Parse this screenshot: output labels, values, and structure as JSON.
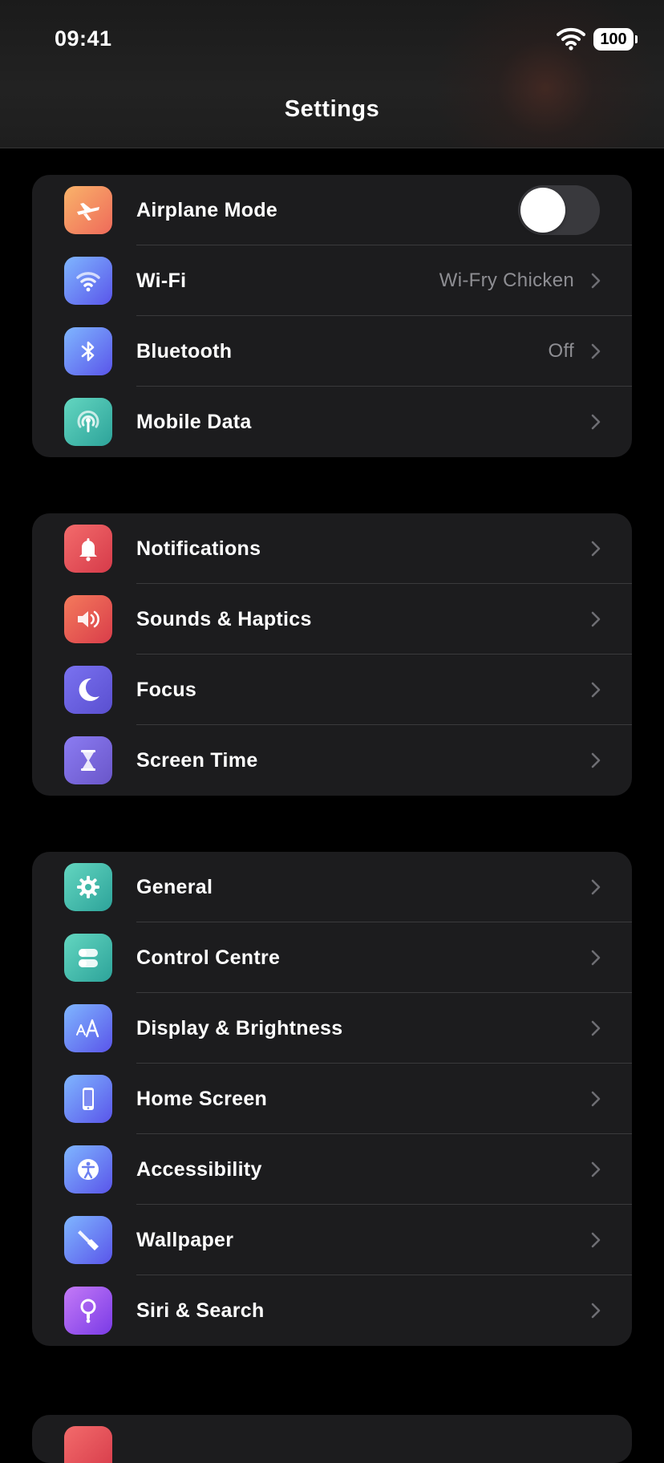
{
  "status_bar": {
    "time": "09:41",
    "battery": "100"
  },
  "title": "Settings",
  "groups": [
    {
      "rows": [
        {
          "label": "Airplane Mode",
          "icon": "airplane-icon",
          "toggle": false
        },
        {
          "label": "Wi-Fi",
          "value": "Wi-Fry Chicken",
          "icon": "wifi-icon"
        },
        {
          "label": "Bluetooth",
          "value": "Off",
          "icon": "bluetooth-icon"
        },
        {
          "label": "Mobile Data",
          "icon": "antenna-icon"
        }
      ]
    },
    {
      "rows": [
        {
          "label": "Notifications",
          "icon": "bell-icon"
        },
        {
          "label": "Sounds & Haptics",
          "icon": "speaker-icon"
        },
        {
          "label": "Focus",
          "icon": "moon-icon"
        },
        {
          "label": "Screen Time",
          "icon": "hourglass-icon"
        }
      ]
    },
    {
      "rows": [
        {
          "label": "General",
          "icon": "gear-icon"
        },
        {
          "label": "Control Centre",
          "icon": "toggles-icon"
        },
        {
          "label": "Display & Brightness",
          "icon": "text-size-icon"
        },
        {
          "label": "Home Screen",
          "icon": "phone-icon"
        },
        {
          "label": "Accessibility",
          "icon": "accessibility-icon"
        },
        {
          "label": "Wallpaper",
          "icon": "brush-icon"
        },
        {
          "label": "Siri & Search",
          "icon": "siri-icon"
        }
      ]
    }
  ]
}
